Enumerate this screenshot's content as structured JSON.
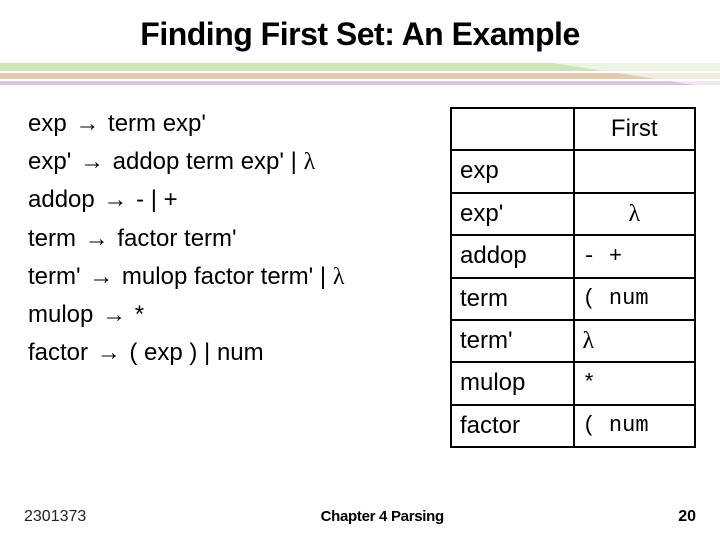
{
  "glyphs": {
    "arrow": "→",
    "lambda": "λ"
  },
  "title": "Finding First Set: An Example",
  "grammar": [
    {
      "lhs": "exp",
      "rhs": "term exp'",
      "alt": null
    },
    {
      "lhs": "exp'",
      "rhs": "addop term exp'",
      "alt": "λ"
    },
    {
      "lhs": "addop",
      "rhs": "- | +",
      "alt": null
    },
    {
      "lhs": "term",
      "rhs": "factor term'",
      "alt": null
    },
    {
      "lhs": "term'",
      "rhs": "mulop factor term'",
      "alt": "λ"
    },
    {
      "lhs": "mulop",
      "rhs": "*",
      "alt": null
    },
    {
      "lhs": "factor",
      "rhs": "( exp ) | num",
      "alt": null
    }
  ],
  "table": {
    "header_nt": "",
    "header_first": "First",
    "rows": [
      {
        "nt": "exp",
        "first": "",
        "style": "plain"
      },
      {
        "nt": "exp'",
        "first": "λ",
        "style": "lambda-center"
      },
      {
        "nt": "addop",
        "first": "- +",
        "style": "mono"
      },
      {
        "nt": "term",
        "first": "( num",
        "style": "mono"
      },
      {
        "nt": "term'",
        "first": "λ",
        "style": "lambda"
      },
      {
        "nt": "mulop",
        "first": "*",
        "style": "mono"
      },
      {
        "nt": "factor",
        "first": "( num",
        "style": "mono"
      }
    ]
  },
  "footer": {
    "course": "2301373",
    "chapter": "Chapter 4  Parsing",
    "page": "20"
  }
}
